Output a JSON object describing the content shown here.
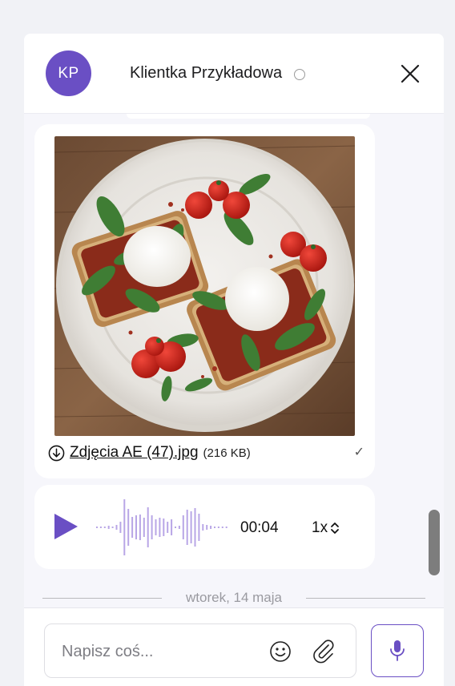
{
  "header": {
    "avatar_initials": "KP",
    "contact_name": "Klientka Przykładowa",
    "status": "offline",
    "close_icon": "close-icon"
  },
  "messages": {
    "image_message": {
      "image_alt": "Zdjęcie kanapek z mozzarellą, rukolą i pomidorkami koktajlowymi",
      "download_icon": "download-icon",
      "file_name": "Zdjęcia AE (47).jpg",
      "file_size": "(216 KB)",
      "read_receipt": "✓"
    },
    "audio_message": {
      "play_icon": "play-icon",
      "duration": "00:04",
      "speed": "1x"
    },
    "date_separator": "wtorek, 14 maja"
  },
  "composer": {
    "placeholder": "Napisz coś...",
    "value": "",
    "emoji_icon": "smiley-icon",
    "attach_icon": "paperclip-icon",
    "mic_icon": "microphone-icon"
  },
  "colors": {
    "accent": "#6a4fc4",
    "waveform": "#b8a6e6",
    "bubble": "#ffffff",
    "background": "#f6f6fb"
  }
}
